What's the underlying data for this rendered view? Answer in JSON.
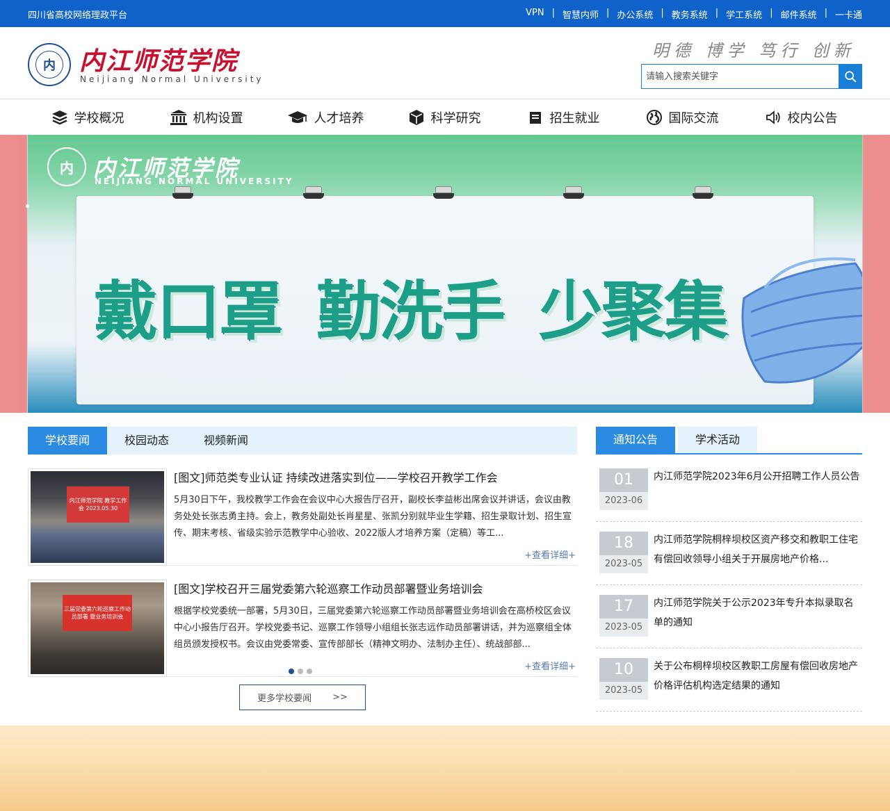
{
  "topbar": {
    "platform": "四川省高校网络理政平台",
    "links": [
      "VPN",
      "智慧内师",
      "办公系统",
      "教务系统",
      "学工系统",
      "邮件系统",
      "一卡通"
    ]
  },
  "header": {
    "logo_cn": "内江师范学院",
    "logo_en": "Neijiang Normal University",
    "seal_text": "内",
    "motto": "明德 博学 笃行 创新",
    "search_placeholder": "请输入搜索关键字"
  },
  "nav": [
    {
      "label": "学校概况",
      "icon": "layers-icon"
    },
    {
      "label": "机构设置",
      "icon": "institution-icon"
    },
    {
      "label": "人才培养",
      "icon": "graduation-cap-icon"
    },
    {
      "label": "科学研究",
      "icon": "cube-icon"
    },
    {
      "label": "招生就业",
      "icon": "briefcase-icon"
    },
    {
      "label": "国际交流",
      "icon": "globe-icon"
    },
    {
      "label": "校内公告",
      "icon": "speaker-icon"
    }
  ],
  "banner": {
    "logo_cn": "内江师范学院",
    "logo_en": "NEIJIANG NORMAL UNIVERSITY",
    "slogans": [
      "戴口罩",
      "勤洗手",
      "少聚集"
    ]
  },
  "news": {
    "tabs": [
      "学校要闻",
      "校园动态",
      "视频新闻"
    ],
    "items": [
      {
        "title": "[图文]师范类专业认证 持续改进落实到位——学校召开教学工作会",
        "summary": "5月30日下午，我校教学工作会在会议中心大报告厅召开，副校长李益彬出席会议并讲话，会议由教务处处长张志勇主持。会上，教务处副处长肖星星、张凯分别就毕业生学籍、招生录取计划、招生宣传、期末考核、省级实验示范教学中心验收、2022版人才培养方案（定稿）等工...",
        "more": "+查看详细+",
        "screen_text": "内江师范学院 教学工作会 2023.05.30",
        "screen_color": "#d23a3a"
      },
      {
        "title": "[图文]学校召开三届党委第六轮巡察工作动员部署暨业务培训会",
        "summary": "根据学校党委统一部署，5月30日，三届党委第六轮巡察工作动员部署暨业务培训会在高桥校区会议中心小报告厅召开。学校党委书记、巡察工作领导小组组长张志远作动员部署讲话，并为巡察组全体组员颁发授权书。会议由党委常委、宣传部部长（精神文明办、法制办主任）、统战部部...",
        "more": "+查看详细+",
        "screen_text": "三届党委第六轮巡察工作动员部署 暨业务培训会",
        "screen_color": "#d8322c"
      }
    ],
    "more_button": "更多学校要闻",
    "more_arrows": ">>"
  },
  "notices": {
    "tabs": [
      "通知公告",
      "学术活动"
    ],
    "items": [
      {
        "day": "01",
        "ym": "2023-06",
        "title": "内江师范学院2023年6月公开招聘工作人员公告"
      },
      {
        "day": "18",
        "ym": "2023-05",
        "title": "内江师范学院桐梓坝校区资产移交和教职工住宅有偿回收领导小组关于开展房地产价格..."
      },
      {
        "day": "17",
        "ym": "2023-05",
        "title": "内江师范学院关于公示2023年专升本拟录取名单的通知"
      },
      {
        "day": "10",
        "ym": "2023-05",
        "title": "关于公布桐梓坝校区教职工房屋有偿回收房地产价格评估机构选定结果的通知"
      }
    ]
  },
  "colors": {
    "topbar": "#0f62c9",
    "accent": "#2b8ae2",
    "brand_red": "#c8102e",
    "dark_blue": "#1f4f93"
  }
}
